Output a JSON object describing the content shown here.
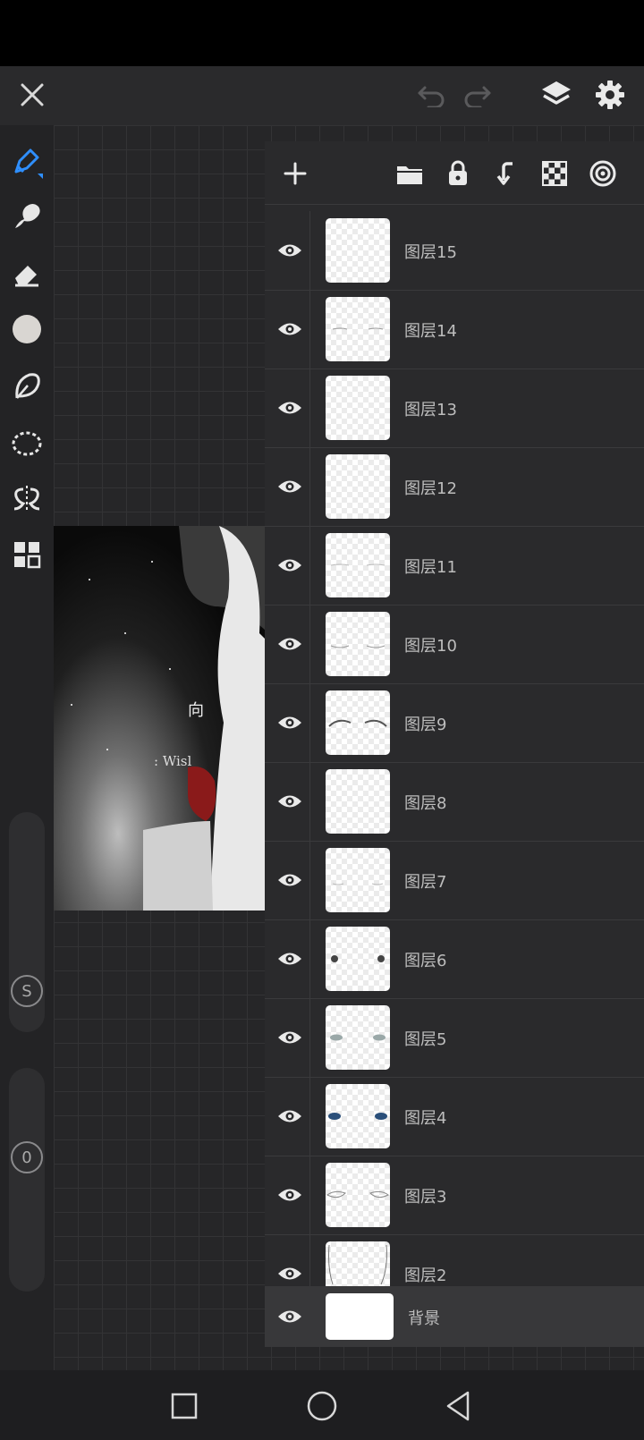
{
  "top_bar": {
    "close_icon": "close-icon",
    "undo_icon": "undo-icon",
    "redo_icon": "redo-icon",
    "layers_icon": "layers-icon",
    "settings_icon": "gear-icon"
  },
  "left_toolbar": {
    "tools": [
      "pen-icon",
      "smudge-icon",
      "eraser-icon",
      "color-swatch",
      "lasso-fill-icon",
      "selection-icon",
      "symmetry-icon",
      "gallery-icon"
    ],
    "brush_size_label": "S",
    "opacity_label": "0",
    "accent_color": "#2f8fff",
    "current_color": "#d9d6d2"
  },
  "layer_panel": {
    "toolbar_icons": [
      "add-icon",
      "folder-icon",
      "lock-icon",
      "merge-down-icon",
      "transparency-icon",
      "target-icon"
    ],
    "layers": [
      {
        "name": "图层15",
        "visible": true
      },
      {
        "name": "图层14",
        "visible": true
      },
      {
        "name": "图层13",
        "visible": true
      },
      {
        "name": "图层12",
        "visible": true
      },
      {
        "name": "图层11",
        "visible": true
      },
      {
        "name": "图层10",
        "visible": true
      },
      {
        "name": "图层9",
        "visible": true
      },
      {
        "name": "图层8",
        "visible": true
      },
      {
        "name": "图层7",
        "visible": true
      },
      {
        "name": "图层6",
        "visible": true
      },
      {
        "name": "图层5",
        "visible": true
      },
      {
        "name": "图层4",
        "visible": true
      },
      {
        "name": "图层3",
        "visible": true
      },
      {
        "name": "图层2",
        "visible": true
      }
    ],
    "background_layer": {
      "name": "背景",
      "visible": true
    }
  },
  "canvas": {
    "artwork_text_1": "向",
    "artwork_text_2": ": Wisl"
  },
  "nav_bar": {
    "icons": [
      "recent-apps-icon",
      "home-icon",
      "back-icon"
    ]
  }
}
